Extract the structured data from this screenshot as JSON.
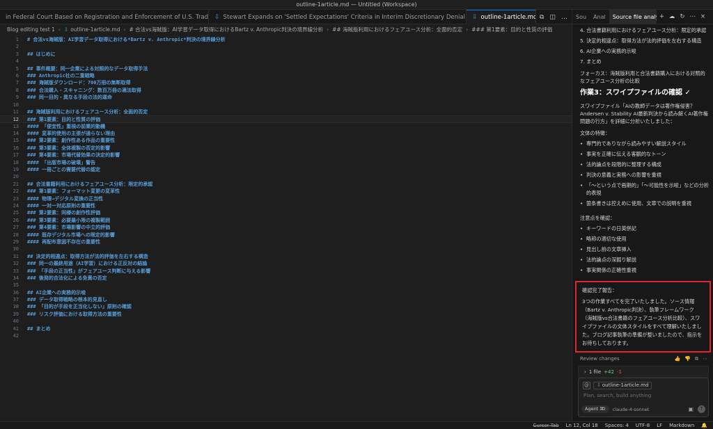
{
  "window": {
    "title": "outline-1article.md — Untitled (Workspace)"
  },
  "tabs": [
    {
      "label": "in Federal Court Based on Registration and Enforcement of U.S. Trademarks.md",
      "active": false
    },
    {
      "label": "Stewart Expands on 'Settled Expectations' Criteria in Interim Discretionary Denial Process.md",
      "active": false
    },
    {
      "label": "outline-1article.md",
      "active": true
    }
  ],
  "tab_close": "×",
  "breadcrumb": {
    "items": [
      "Blog editing test 1",
      "outline-1article.md",
      "# 合法vs海賊版：AI学習データ取得におけるBartz v. Anthropic判決の境界線分析",
      "## 海賊版利用におけるフェアユース分析：全面的否定",
      "### 第1要素：目的と性質の評価"
    ]
  },
  "code_lines": [
    "# 合法vs海賊版：AI学習データ取得における*Bartz v. Anthropic*判決の境界線分析",
    "",
    "## はじめに",
    "",
    "## 事件概要：同一企業による対照的なデータ取得手法",
    "### Anthropic社の二重戦略",
    "### 海賊版ダウンロード：700万冊の無断取得",
    "### 合法購入・スキャニング：数百万冊の適法取得",
    "### 同一目的・異なる手段の法的運命",
    "",
    "## 海賊版利用におけるフェアユース分析：全面的否定",
    "### 第1要素：目的と性質の評価",
    "#### 「便宜性」重視の前業的動機",
    "#### 変革的使用の主張が通らない理由",
    "### 第2要素：創作性ある作品の重要性",
    "### 第3要素：全体複製の否定的影響",
    "### 第4要素：市場代替効果の決定的影響",
    "#### 「出版市場の破壊」警告",
    "#### 一冊ごとの需要代替の認定",
    "",
    "## 合法書籍利用におけるフェアユース分析：限定的承認",
    "### 第1要素：フォーマット変更の変革性",
    "#### 物理→デジタル変換の正当性",
    "#### 一対一対応原則の重要性",
    "### 第2要素：同様の創作性評価",
    "### 第3要素：必要最小限の複製範囲",
    "### 第4要素：市場影響の中立的評価",
    "#### 既存デジタル市場への限定的影響",
    "#### 再配布意図不存在の重要性",
    "",
    "## 決定的相違点：取得方法が法的評価を左右する構造",
    "### 同一の最終用途（AI学習）における正反対の結論",
    "### 「手段の正当性」がフェアユース判断に与える影響",
    "### 後発的合法化による免責の否定",
    "",
    "## AI企業への実務的示唆",
    "### データ取得戦略の根本的見直し",
    "### 「目的が手段を正当化しない」原則の確認",
    "### リスク評価における取得方法の重要性",
    "",
    "## まとめ",
    ""
  ],
  "current_line": 12,
  "panel": {
    "tabs": [
      "Sou",
      "Anal",
      "Source file analy"
    ],
    "active_tab": 2,
    "outline_items": [
      "4. 合法書籍利用におけるフェアユース分析：限定的承認",
      "5. 決定的相違点：取得方法が法的評価を左右する構造",
      "6. AI企業への実務的示唆",
      "7. まとめ"
    ],
    "focus": "フォーカス：海賊版利用と合法書籍購入における対照的なフェアユース分析の比較",
    "task_heading": "作業3：スワイプファイルの確認 ✓",
    "swipe_intro": "スワイプファイル「AIの教師データは著作権侵害？ Andersen v. Stability AI最新判決から読み解くAI著作権問題の行方」を詳細に分析いたしました：",
    "style_label": "文体の特徴：",
    "style_items": [
      "専門的でありながら読みやすい解説スタイル",
      "事実を正確に伝える客観的なトーン",
      "法的論点を段階的に整理する構成",
      "判決の意義と実務への影響を重視",
      "「〜という点で画期的」「〜可能性を示唆」などの分析的表現",
      "箇条書きは控えめに使用、文章での説明を重視"
    ],
    "notes_label": "注意点を確認：",
    "notes_items": [
      "キーワードの日英併記",
      "略称の適切な使用",
      "見出し前の文章挿入",
      "法的論点の深掘り解説",
      "事実関係の正確性重視"
    ],
    "report_title": "確認完了報告：",
    "report_body": "3つの作業すべてを完了いたしました。ソース情報（Bartz v. Anthropic判決）、執筆フレームワーク（海賊版vs合法書籍のフェアユース分析比較）、スワイプファイルの文体スタイルをすべて理解いたしました。ブログ記事執筆の準備が整いましたので、指示をお待ちしております。",
    "review_label": "Review changes",
    "file_count": "1 file",
    "added": "+42",
    "removed": "-1",
    "context_file": "outline-1article.md",
    "chat_placeholder": "Plan, search, build anything",
    "agent_label": "Agent ⌘I",
    "model_label": "claude-4-sonnet"
  },
  "status": {
    "cursor_tab": "Cursor Tab",
    "position": "Ln 12, Col 18",
    "spaces": "Spaces: 4",
    "encoding": "UTF-8",
    "eol": "LF",
    "language": "Markdown"
  },
  "colors": {
    "accent": "#0078d4",
    "heading_blue": "#569cd6",
    "highlight_border": "#e0282c"
  }
}
